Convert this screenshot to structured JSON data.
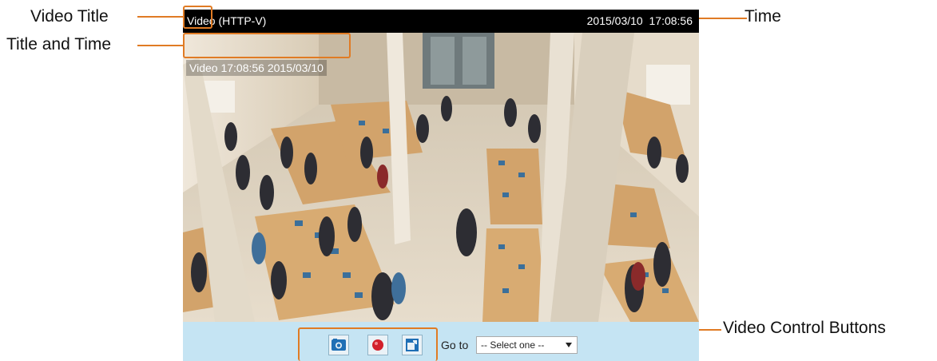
{
  "callouts": {
    "video_title": "Video Title",
    "title_and_time": "Title and Time",
    "time": "Time",
    "video_control_buttons": "Video Control Buttons"
  },
  "viewer": {
    "title_left_name": "Video",
    "title_left_protocol": " (HTTP-V)",
    "title_right_date": "2015/03/10",
    "title_right_time": "17:08:56",
    "overlay_text": "Video 17:08:56  2015/03/10"
  },
  "controls": {
    "snapshot": "camera-icon",
    "record": "record-icon",
    "fullscreen": "popout-icon",
    "goto_label": "Go to",
    "goto_selected": "-- Select one --"
  },
  "colors": {
    "accent": "#e07b24",
    "control_bar": "#c5e4f3",
    "title_bar": "#000000"
  }
}
